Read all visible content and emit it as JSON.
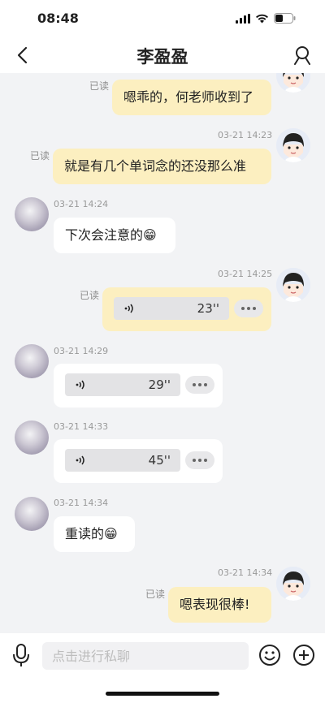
{
  "status": {
    "time": "08:48"
  },
  "header": {
    "title": "李盈盈"
  },
  "messages": {
    "m1": {
      "read": "已读",
      "text": "嗯乖的，何老师收到了"
    },
    "m2": {
      "time": "03-21 14:23",
      "read": "已读",
      "text": "就是有几个单词念的还没那么准"
    },
    "m3": {
      "time": "03-21 14:24",
      "text": "下次会注意的😁"
    },
    "m4": {
      "time": "03-21 14:25",
      "read": "已读",
      "duration": "23''"
    },
    "m5": {
      "time": "03-21 14:29",
      "duration": "29''"
    },
    "m6": {
      "time": "03-21 14:33",
      "duration": "45''"
    },
    "m7": {
      "time": "03-21 14:34",
      "text": "重读的😁"
    },
    "m8": {
      "time": "03-21 14:34",
      "read": "已读",
      "text": "嗯表现很棒!"
    }
  },
  "composer": {
    "placeholder": "点击进行私聊"
  },
  "colors": {
    "my_bubble": "#fcefc0",
    "other_bubble": "#ffffff",
    "background": "#f2f3f5"
  }
}
